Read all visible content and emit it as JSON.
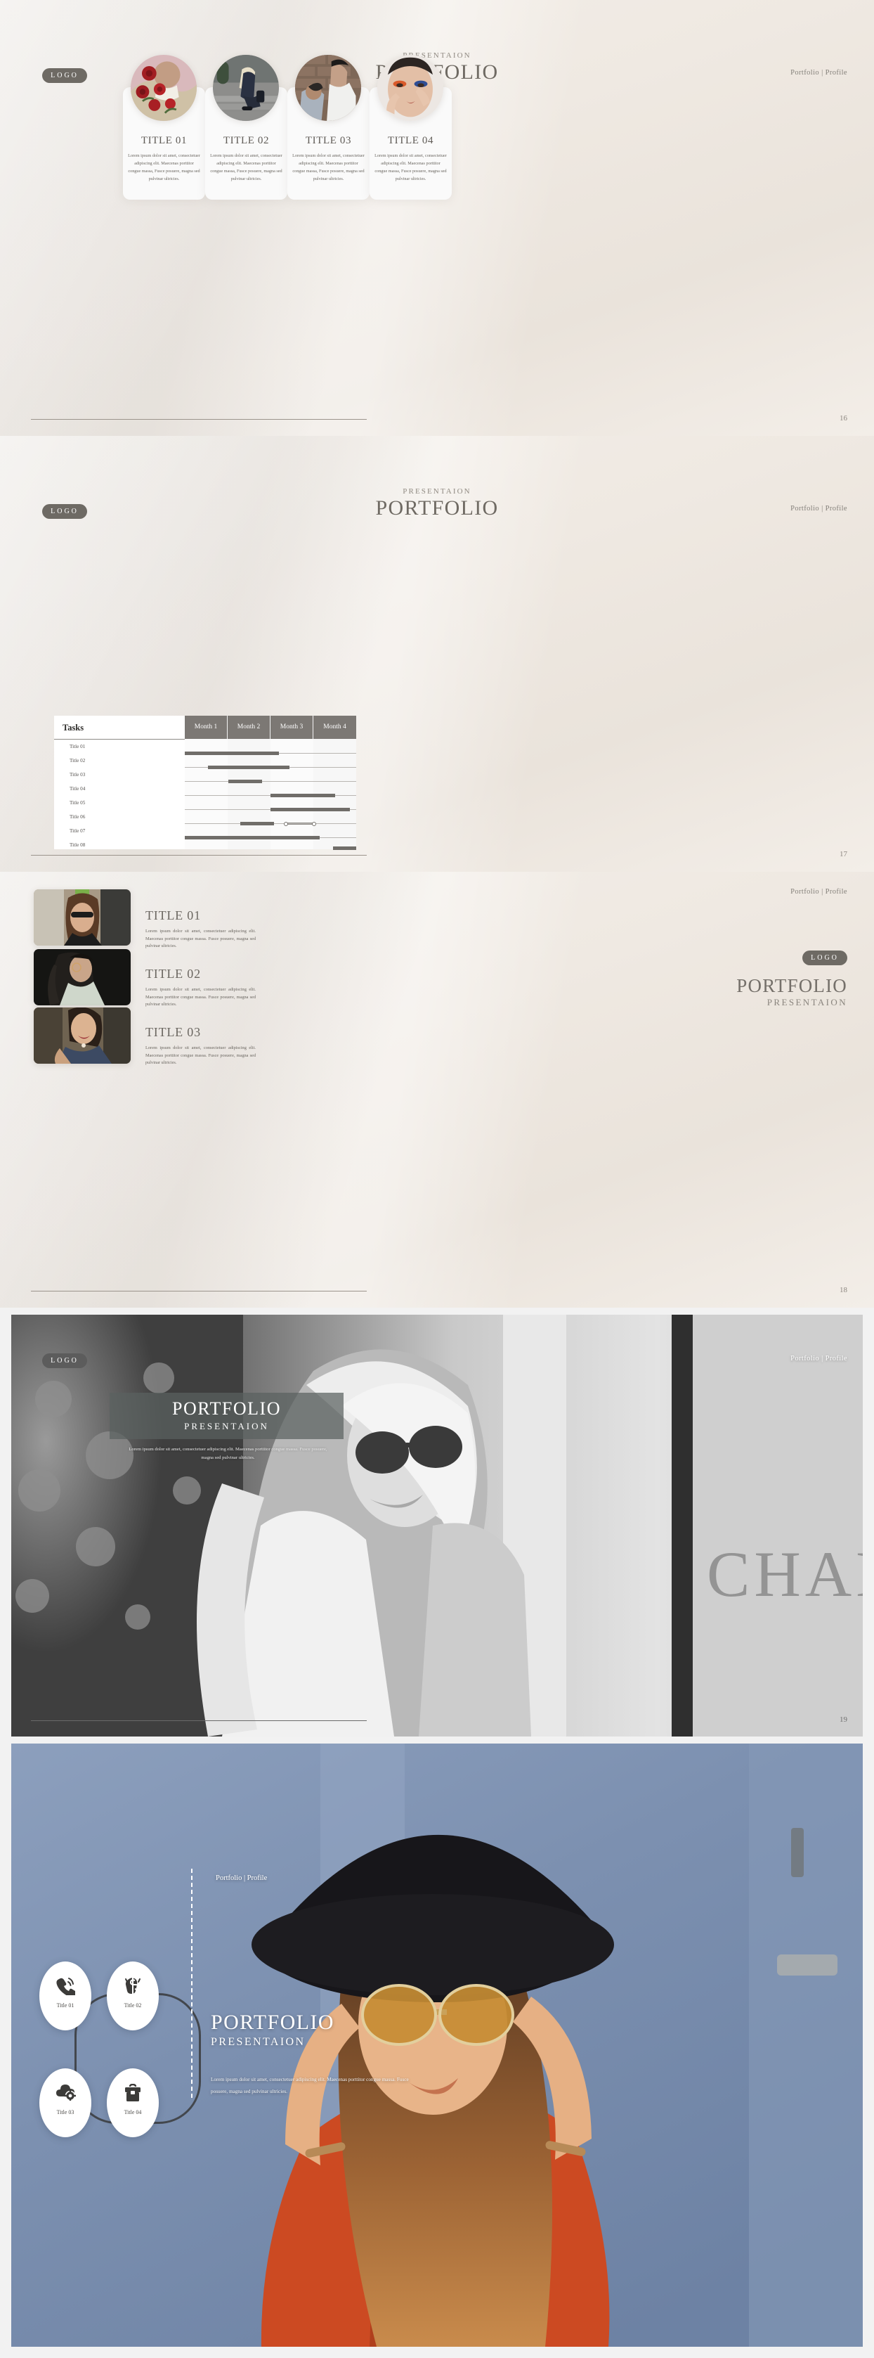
{
  "brand": {
    "logo_label": "LOGO",
    "nav": "Portfolio | Profile",
    "eyebrow": "PRESENTAION",
    "title": "PORTFOLIO"
  },
  "slide16": {
    "page_number": "16",
    "cards": [
      {
        "title": "TITLE 01",
        "body": "Lorem ipsum dolor sit amet, consectetuer adipiscing elit. Maecenas porttitor congue massa, Fusce posuere, magna sed pulvinar ultricies."
      },
      {
        "title": "TITLE 02",
        "body": "Lorem ipsum dolor sit amet, consectetuer adipiscing elit. Maecenas porttitor congue massa, Fusce posuere, magna sed pulvinar ultricies."
      },
      {
        "title": "TITLE 03",
        "body": "Lorem ipsum dolor sit amet, consectetuer adipiscing elit. Maecenas porttitor congue massa, Fusce posuere, magna sed pulvinar ultricies."
      },
      {
        "title": "TITLE 04",
        "body": "Lorem ipsum dolor sit amet, consectetuer adipiscing elit. Maecenas porttitor congue massa, Fusce posuere, magna sed pulvinar ultricies."
      }
    ]
  },
  "slide17": {
    "page_number": "17",
    "tasks_header": "Tasks",
    "chart_data": {
      "type": "bar",
      "title": "Tasks",
      "xlabel": "",
      "ylabel": "",
      "categories": [
        "Title 01",
        "Title 02",
        "Title 03",
        "Title 04",
        "Title 05",
        "Title 06",
        "Title 07",
        "Title 08"
      ],
      "columns": [
        "Month 1",
        "Month 2",
        "Month 3",
        "Month 4"
      ],
      "xlim": [
        0,
        4
      ],
      "grid": true,
      "legend": "none",
      "bars": [
        {
          "task": "Title 01",
          "start": 0.0,
          "end": 2.2
        },
        {
          "task": "Title 02",
          "start": 0.55,
          "end": 2.45
        },
        {
          "task": "Title 03",
          "start": 1.02,
          "end": 1.8
        },
        {
          "task": "Title 04",
          "start": 2.0,
          "end": 3.5
        },
        {
          "task": "Title 05",
          "start": 2.0,
          "end": 3.85
        },
        {
          "task": "Title 06",
          "start": 1.3,
          "end": 2.08
        },
        {
          "task": "Title 07",
          "start": 0.0,
          "end": 3.15
        },
        {
          "task": "Title 08",
          "start": 3.45,
          "end": 4.0
        }
      ],
      "milestone_links": [
        {
          "task": "Title 06",
          "from": 2.35,
          "to": 2.8
        }
      ]
    }
  },
  "slide18": {
    "page_number": "18",
    "items": [
      {
        "title": "TITLE 01",
        "body": "Lorem ipsum dolor sit amet, consectetuer adipiscing elit. Maecenas porttitor congue massa. Fusce posuere, magna sed pulvinar ultricies."
      },
      {
        "title": "TITLE 02",
        "body": "Lorem ipsum dolor sit amet, consectetuer adipiscing elit. Maecenas porttitor congue massa. Fusce posuere, magna sed pulvinar ultricies."
      },
      {
        "title": "TITLE 03",
        "body": "Lorem ipsum dolor sit amet, consectetuer adipiscing elit. Maecenas porttitor congue massa. Fusce posuere, magna sed pulvinar ultricies."
      }
    ]
  },
  "slide19": {
    "page_number": "19",
    "overlay_title": "PORTFOLIO",
    "overlay_sub": "PRESENTAION",
    "caption": "Lorem ipsum dolor sit amet, consectetuer adipiscing elit. Maecenas porttitor congue massa. Fusce posuere, magna sed pulvinar ultricies.",
    "photo_text": "CHANEL"
  },
  "slide20": {
    "nav": "Portfolio | Profile",
    "title": "PORTFOLIO",
    "subtitle": "PRESENTAION",
    "body": "Lorem ipsum dolor sit amet, consectetuer adipiscing elit. Maecenas porttitor congue massa. Fusce posuere, magna sed pulvinar ultricies.",
    "nodes": [
      {
        "label": "Title 01",
        "icon": "phone-call-icon"
      },
      {
        "label": "Title 02",
        "icon": "money-hand-icon"
      },
      {
        "label": "Title 03",
        "icon": "cloud-settings-icon"
      },
      {
        "label": "Title 04",
        "icon": "briefcase-icon"
      }
    ]
  },
  "colors": {
    "accent_dark": "#6e6a64",
    "bar": "#706d69",
    "header_row": "#7c7874",
    "background": "#f2f2f2",
    "slide_beige": "#efe9e2"
  }
}
